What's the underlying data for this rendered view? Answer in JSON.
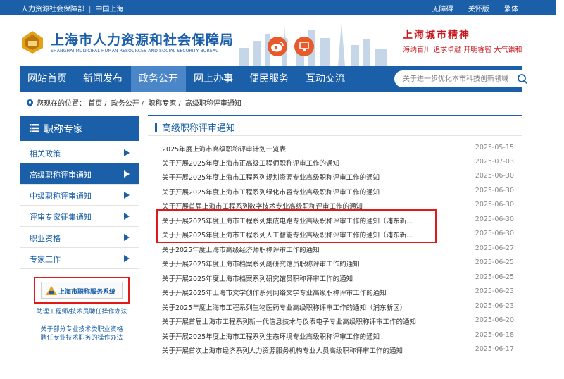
{
  "topbar": {
    "left_items": [
      "人力资源社会保障部",
      "中国上海"
    ],
    "right_items": [
      "无障碍",
      "关怀版",
      "繁体"
    ]
  },
  "header": {
    "title": "上海市人力资源和社会保障局",
    "subtitle": "SHANGHAI MUNICIPAL HUMAN RESOURCES AND SOCIAL SECURITY BUREAU",
    "spirit_title": "上海城市精神",
    "spirit_text": "海纳百川 追求卓越 开明睿智 大气谦和",
    "icons": [
      "weibo-icon",
      "app-icon"
    ]
  },
  "nav": {
    "items": [
      {
        "label": "网站首页",
        "active": false
      },
      {
        "label": "新闻发布",
        "active": false
      },
      {
        "label": "政务公开",
        "active": true
      },
      {
        "label": "网上办事",
        "active": false
      },
      {
        "label": "便民服务",
        "active": false
      },
      {
        "label": "互动交流",
        "active": false
      }
    ],
    "search_placeholder": "关于进一步优化本市科技创新领域"
  },
  "breadcrumb": {
    "prefix": "您现在的位置：",
    "items": [
      "首页",
      "政务公开",
      "职称专家",
      "高级职称评审通知"
    ]
  },
  "sidebar": {
    "title": "职称专家",
    "items": [
      {
        "label": "相关政策",
        "active": false
      },
      {
        "label": "高级职称评审通知",
        "active": true
      },
      {
        "label": "中级职称评审通知",
        "active": false
      },
      {
        "label": "评审专家征集通知",
        "active": false
      },
      {
        "label": "职业资格",
        "active": false
      },
      {
        "label": "专家工作",
        "active": false
      }
    ],
    "banner_text": "上海市职称服务系统",
    "links": [
      "助理工程师/技术员聘任操作办法",
      "关于部分专业技术类职业资格",
      "聘任专业技术职务的操作办法"
    ]
  },
  "main": {
    "title": "高级职称评审通知",
    "rows": [
      {
        "title": "2025年度上海市高级职称评审计划一览表",
        "date": "2025-05-15"
      },
      {
        "title": "关于开展2025年度上海市正高级工程师职称评审工作的通知",
        "date": "2025-07-03"
      },
      {
        "title": "关于开展2025年度上海市工程系列规划资源专业高级职称评审工作的通知",
        "date": "2025-06-30"
      },
      {
        "title": "关于开展2025年度上海市工程系列绿化市容专业高级职称评审工作的通知",
        "date": "2025-06-30"
      },
      {
        "title": "关于开展首届上海市工程系列数字技术专业高级职称评审工作的通知",
        "date": "2025-06-30"
      },
      {
        "title": "关于开展2025年度上海市工程系列集成电路专业高级职称评审工作的通知（浦东新...",
        "date": "2025-06-30"
      },
      {
        "title": "关于开展2025年度上海市工程系列人工智能专业高级职称评审工作的通知（浦东新...",
        "date": "2025-06-30"
      },
      {
        "title": "关于2025年度上海市高级经济师职称评审工作的通知",
        "date": "2025-06-27"
      },
      {
        "title": "关于开展2025年度上海市档案系列副研究馆员职称评审工作的通知",
        "date": "2025-06-25"
      },
      {
        "title": "关于开展2025年度上海市档案系列研究馆员职称评审工作的通知",
        "date": "2025-06-25"
      },
      {
        "title": "关于开展2025年上海市文学创作系列网络文学专业高级职称评审工作的通知",
        "date": "2025-06-23"
      },
      {
        "title": "关于2025年度上海市工程系列生物医药专业高级职称评审工作的通知（浦东新区）",
        "date": "2025-06-23"
      },
      {
        "title": "关于开展首届上海市工程系列新一代信息技术与仪表电子专业高级职称评审工作的通知",
        "date": "2025-06-20"
      },
      {
        "title": "关于开展2025年度上海市工程系列生态环境专业高级职称评审工作的通知",
        "date": "2025-06-18"
      },
      {
        "title": "关于开展首次上海市经济系列人力资源服务机构专业人员高级职称评审工作的通知",
        "date": "2025-06-17"
      }
    ]
  },
  "colors": {
    "primary": "#1a5fa8",
    "nav_active": "#4a86c8",
    "highlight": "#e0191b",
    "accent_red": "#c8161d",
    "icon_orange": "#e85a2c"
  }
}
